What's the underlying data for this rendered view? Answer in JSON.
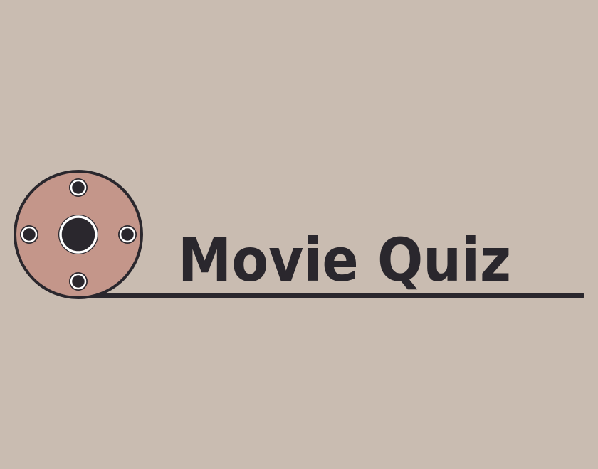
{
  "title": "Movie Quiz",
  "icon": "film-reel-icon",
  "colors": {
    "background": "#c9bcb1",
    "reel_fill": "#c4968a",
    "ink": "#2a272d",
    "highlight": "#ffffff"
  }
}
